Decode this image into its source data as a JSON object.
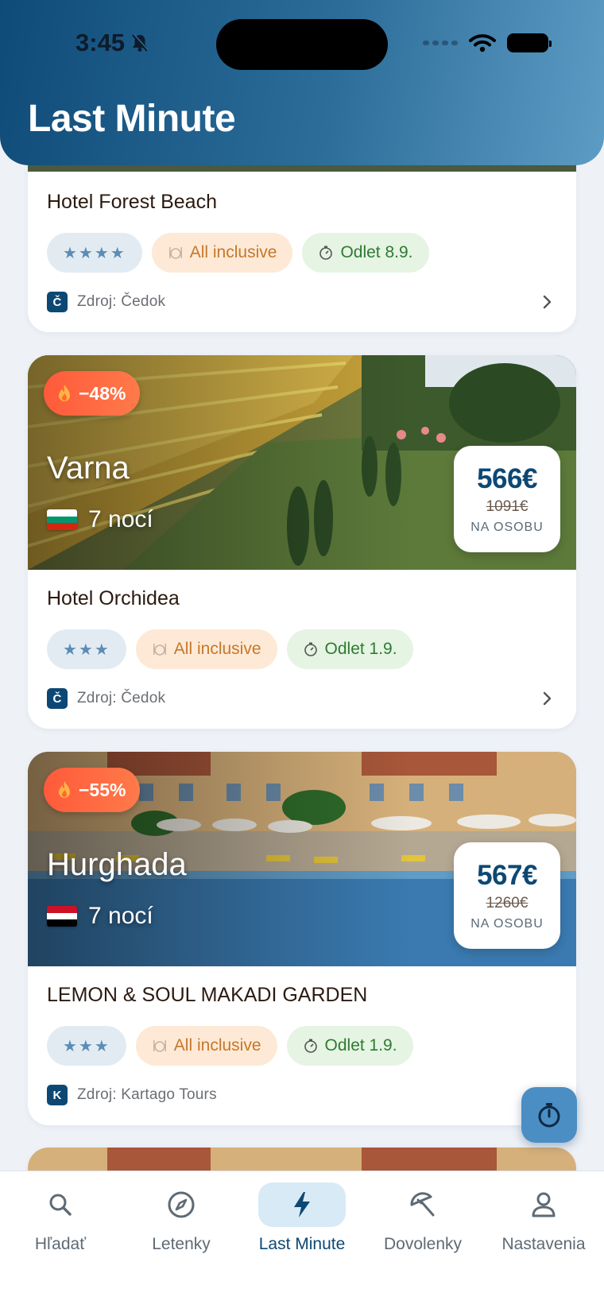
{
  "status_bar": {
    "time": "3:45"
  },
  "header": {
    "title": "Last Minute"
  },
  "cards": [
    {
      "hotel": "Hotel Forest Beach",
      "stars": "★★★★",
      "board": "All inclusive",
      "departure": "Odlet 8.9.",
      "source": "Zdroj: Čedok",
      "source_logo": "Č"
    },
    {
      "discount": "−48%",
      "destination": "Varna",
      "nights": "7 nocí",
      "price": "566€",
      "old_price": "1091€",
      "per_person": "NA OSOBU",
      "hotel": "Hotel Orchidea",
      "stars": "★★★",
      "board": "All inclusive",
      "departure": "Odlet 1.9.",
      "source": "Zdroj: Čedok",
      "source_logo": "Č"
    },
    {
      "discount": "−55%",
      "destination": "Hurghada",
      "nights": "7 nocí",
      "price": "567€",
      "old_price": "1260€",
      "per_person": "NA OSOBU",
      "hotel": "LEMON & SOUL MAKADI GARDEN",
      "stars": "★★★",
      "board": "All inclusive",
      "departure": "Odlet 1.9.",
      "source": "Zdroj: Kartago Tours",
      "source_logo": "K"
    }
  ],
  "tabs": [
    {
      "label": "Hľadať",
      "icon": "search-icon"
    },
    {
      "label": "Letenky",
      "icon": "compass-icon"
    },
    {
      "label": "Last Minute",
      "icon": "lightning-icon",
      "active": true
    },
    {
      "label": "Dovolenky",
      "icon": "umbrella-icon"
    },
    {
      "label": "Nastavenia",
      "icon": "person-icon"
    }
  ],
  "colors": {
    "brand": "#0d4874",
    "accent": "#4a8ec4",
    "discount": "#ff5a3a",
    "board_chip": "#fde9d6",
    "departure_chip": "#e5f4e3",
    "stars_chip": "#e3ebf2"
  }
}
